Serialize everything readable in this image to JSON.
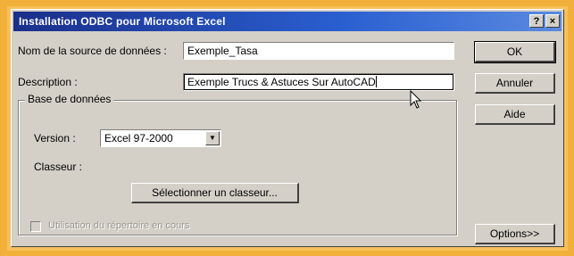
{
  "window": {
    "title": "Installation ODBC pour Microsoft Excel",
    "help_button": "?",
    "close_button": "×"
  },
  "form": {
    "source_name_label": "Nom de la source de données :",
    "source_name_value": "Exemple_Tasa",
    "description_label": "Description :",
    "description_value": "Exemple Trucs & Astuces Sur AutoCAD",
    "database_group_label": "Base de données",
    "version_label": "Version :",
    "version_value": "Excel 97-2000",
    "workbook_label": "Classeur :",
    "select_workbook_button": "Sélectionner un classeur...",
    "current_dir_label": "Utilisation du répertoire en cours",
    "current_dir_checked": false
  },
  "buttons": {
    "ok": "OK",
    "cancel": "Annuler",
    "help": "Aide",
    "options": "Options>>"
  },
  "colors": {
    "background": "#f2b03a",
    "titlebar_start": "#1a2f8a",
    "titlebar_end": "#5a8ae0",
    "dialog_face": "#d4d0c8"
  }
}
